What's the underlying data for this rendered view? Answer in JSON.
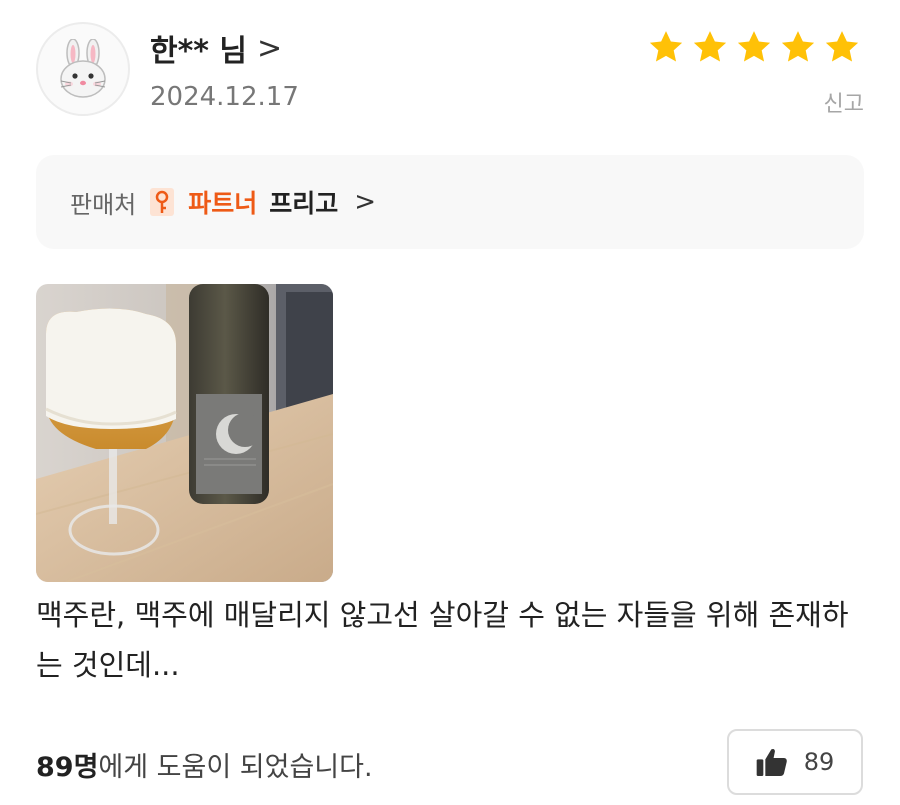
{
  "reviewer": {
    "name": "한** 님",
    "chevron": ">",
    "date": "2024.12.17",
    "avatar_icon": "rabbit-face-icon"
  },
  "rating": {
    "stars": 5,
    "max": 5,
    "color": "#ffc107"
  },
  "report_label": "신고",
  "seller": {
    "label": "판매처",
    "partner_icon": "key-icon",
    "partner_label": "파트너",
    "name": "프리고",
    "chevron": ">"
  },
  "review": {
    "text": "맥주란, 맥주에 매달리지 않고선 살아갈 수 없는 자들을 위해 존재하는 것인데..."
  },
  "helpful": {
    "count_text": "89명",
    "suffix": "에게 도움이 되었습니다."
  },
  "like": {
    "icon": "thumbs-up-icon",
    "count": "89"
  },
  "colors": {
    "accent": "#ee5a16",
    "star": "#ffc107"
  }
}
